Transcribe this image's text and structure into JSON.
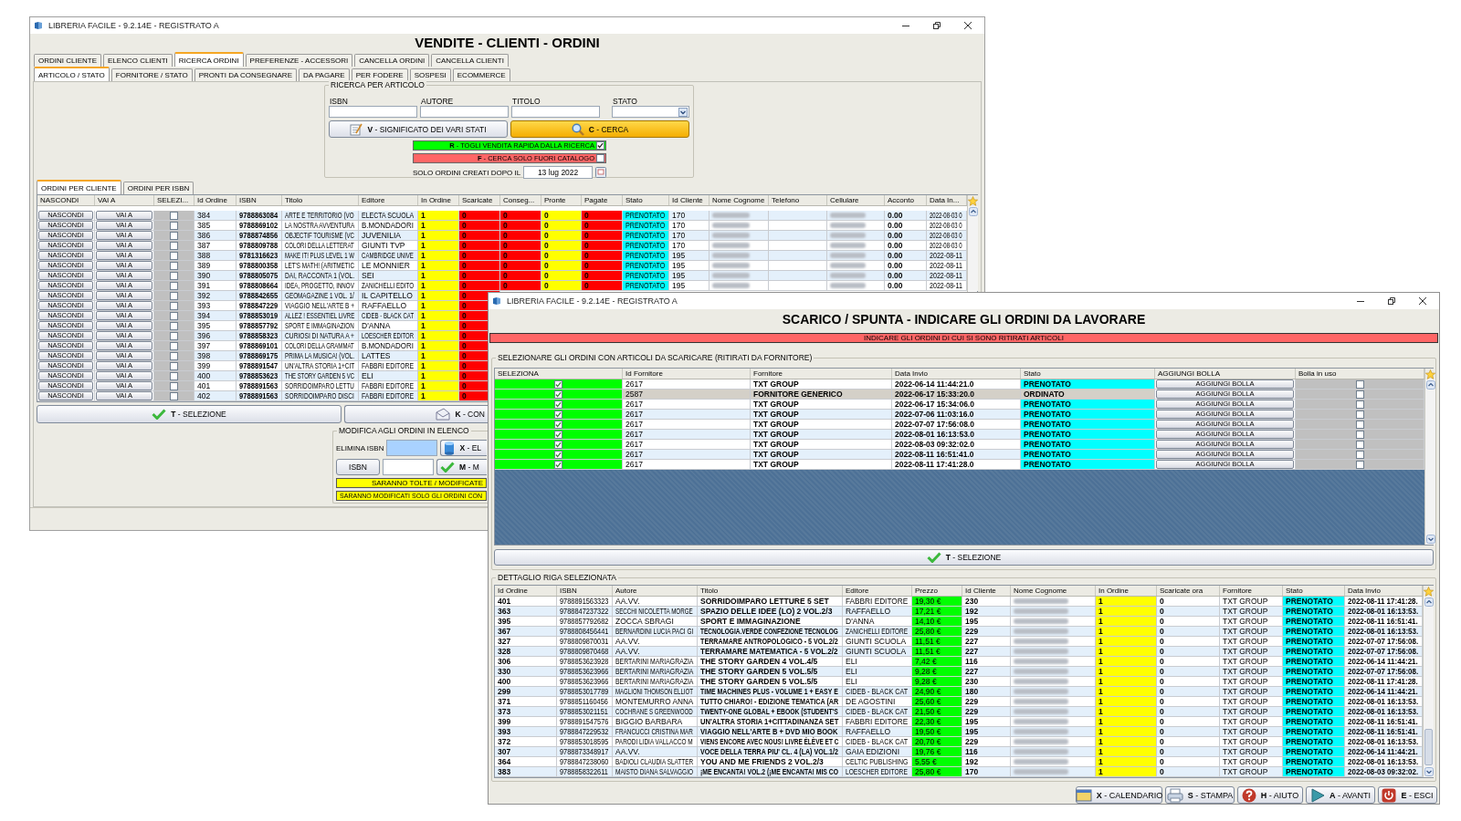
{
  "back_window": {
    "title": "LIBRERIA FACILE - 9.2.14E - REGISTRATO A",
    "heading": "VENDITE - CLIENTI - ORDINI",
    "tabs": [
      {
        "label": "ORDINI CLIENTE",
        "selected": false
      },
      {
        "label": "ELENCO CLIENTI",
        "selected": false
      },
      {
        "label": "RICERCA ORDINI",
        "selected": true
      },
      {
        "label": "PREFERENZE - ACCESSORI",
        "selected": false
      },
      {
        "label": "CANCELLA ORDINI",
        "selected": false
      },
      {
        "label": "CANCELLA CLIENTI",
        "selected": false
      }
    ],
    "subtabs": [
      {
        "label": "ARTICOLO / STATO",
        "selected": true
      },
      {
        "label": "FORNITORE / STATO",
        "selected": false
      },
      {
        "label": "PRONTI DA CONSEGNARE",
        "selected": false
      },
      {
        "label": "DA PAGARE",
        "selected": false
      },
      {
        "label": "PER FODERE",
        "selected": false
      },
      {
        "label": "SOSPESI",
        "selected": false
      },
      {
        "label": "ECOMMERCE",
        "selected": false
      }
    ],
    "search": {
      "legend": "RICERCA PER ARTICOLO",
      "fields": [
        {
          "label": "ISBN",
          "kind": "text"
        },
        {
          "label": "AUTORE",
          "kind": "text"
        },
        {
          "label": "TITOLO",
          "kind": "text"
        },
        {
          "label": "STATO",
          "kind": "dropdown"
        }
      ],
      "states_button": "**V** - SIGNIFICATO DEI VARI STATI",
      "search_button": "**C** - CERCA",
      "toggles": [
        {
          "label": "**R** - TOGLI VENDITA RAPIDA DALLA RICERCA",
          "checked": true,
          "color": "#00ff00"
        },
        {
          "label": "**F** - CERCA SOLO FUORI CATALOGO",
          "checked": false,
          "color": "#ff6666"
        }
      ],
      "date_label": "SOLO ORDINI CREATI DOPO IL",
      "date_value": "13 lug 2022"
    },
    "list_tabs": [
      {
        "label": "ORDINI PER CLIENTE",
        "selected": true
      },
      {
        "label": "ORDINI PER ISBN",
        "selected": false
      }
    ],
    "table": {
      "columns": [
        {
          "label": "NASCONDI",
          "kind": "button"
        },
        {
          "label": "VAI A",
          "kind": "button"
        },
        {
          "label": "SELEZI...",
          "kind": "greycheck"
        },
        {
          "label": "Id Ordine",
          "kind": "text"
        },
        {
          "label": "ISBN",
          "kind": "bold"
        },
        {
          "label": "Titolo",
          "kind": "text"
        },
        {
          "label": "Editore",
          "kind": "text"
        },
        {
          "label": "In Ordine",
          "kind": "yellow"
        },
        {
          "label": "Scaricate",
          "kind": "red"
        },
        {
          "label": "Conseg...",
          "kind": "red"
        },
        {
          "label": "Pronte",
          "kind": "yellow"
        },
        {
          "label": "Pagate",
          "kind": "red"
        },
        {
          "label": "Stato",
          "kind": "cyan"
        },
        {
          "label": "Id Cliente",
          "kind": "text"
        },
        {
          "label": "Nome Cognome",
          "kind": "blurred"
        },
        {
          "label": "Telefono",
          "kind": "empty"
        },
        {
          "label": "Cellulare",
          "kind": "blurred"
        },
        {
          "label": "Acconto",
          "kind": "bold"
        },
        {
          "label": "Data In...",
          "kind": "text"
        }
      ],
      "rows": [
        {
          "checked": false,
          "cells": [
            "NASCONDI",
            "VAI A",
            "",
            "384",
            "9788863084",
            "ARTE E TERRITORIO (VO",
            "ELECTA SCUOLA",
            "1",
            "0",
            "0",
            "0",
            "0",
            "PRENOTATO",
            "170",
            "",
            "",
            "",
            "0.00",
            "2022-08-03 0"
          ]
        },
        {
          "checked": false,
          "cells": [
            "NASCONDI",
            "VAI A",
            "",
            "385",
            "9788869102",
            "LA NOSTRA AVVENTURA",
            "B.MONDADORI",
            "1",
            "0",
            "0",
            "0",
            "0",
            "PRENOTATO",
            "170",
            "",
            "",
            "",
            "0.00",
            "2022-08-03 0"
          ]
        },
        {
          "checked": false,
          "cells": [
            "NASCONDI",
            "VAI A",
            "",
            "386",
            "9788874856",
            "OBJECTIF TOURISME (VC",
            "JUVENILIA",
            "1",
            "0",
            "0",
            "0",
            "0",
            "PRENOTATO",
            "170",
            "",
            "",
            "",
            "0.00",
            "2022-08-03 0"
          ]
        },
        {
          "checked": false,
          "cells": [
            "NASCONDI",
            "VAI A",
            "",
            "387",
            "9788809788",
            "COLORI DELLA LETTERAT",
            "GIUNTI TVP",
            "1",
            "0",
            "0",
            "0",
            "0",
            "PRENOTATO",
            "170",
            "",
            "",
            "",
            "0.00",
            "2022-08-03 0"
          ]
        },
        {
          "checked": false,
          "cells": [
            "NASCONDI",
            "VAI A",
            "",
            "388",
            "9781316623",
            "MAKE IT! PLUS LEVEL 1 W",
            "CAMBRIDGE UNIVE",
            "1",
            "0",
            "0",
            "0",
            "0",
            "PRENOTATO",
            "195",
            "",
            "",
            "",
            "0.00",
            "2022-08-11"
          ]
        },
        {
          "checked": false,
          "cells": [
            "NASCONDI",
            "VAI A",
            "",
            "389",
            "9788800358",
            "LET'S MATH! (ARITMETIC",
            "LE MONNIER",
            "1",
            "0",
            "0",
            "0",
            "0",
            "PRENOTATO",
            "195",
            "",
            "",
            "",
            "0.00",
            "2022-08-11"
          ]
        },
        {
          "checked": false,
          "cells": [
            "NASCONDI",
            "VAI A",
            "",
            "390",
            "9788805075",
            "DAI, RACCONTA 1 (VOL.",
            "SEI",
            "1",
            "0",
            "0",
            "0",
            "0",
            "PRENOTATO",
            "195",
            "",
            "",
            "",
            "0.00",
            "2022-08-11"
          ]
        },
        {
          "checked": false,
          "cells": [
            "NASCONDI",
            "VAI A",
            "",
            "391",
            "9788808664",
            "IDEA, PROGETTO, INNOV",
            "ZANICHELLI EDITO",
            "1",
            "0",
            "0",
            "0",
            "0",
            "PRENOTATO",
            "195",
            "",
            "",
            "",
            "0.00",
            "2022-08-11"
          ]
        },
        {
          "checked": false,
          "cells": [
            "NASCONDI",
            "VAI A",
            "",
            "392",
            "9788842655",
            "GEOMAGAZINE 1 VOL. 1/",
            "IL CAPITELLO",
            "1",
            "0"
          ]
        },
        {
          "checked": false,
          "cells": [
            "NASCONDI",
            "VAI A",
            "",
            "393",
            "9788847229",
            "VIAGGIO NELL'ARTE B +",
            "RAFFAELLO",
            "1",
            "0"
          ]
        },
        {
          "checked": false,
          "cells": [
            "NASCONDI",
            "VAI A",
            "",
            "394",
            "9788853019",
            "ALLEZ ! ESSENTIEL LIVRE",
            "CIDEB - BLACK CAT",
            "1",
            "0"
          ]
        },
        {
          "checked": false,
          "cells": [
            "NASCONDI",
            "VAI A",
            "",
            "395",
            "9788857792",
            "SPORT E IMMAGINAZION",
            "D'ANNA",
            "1",
            "0"
          ]
        },
        {
          "checked": false,
          "cells": [
            "NASCONDI",
            "VAI A",
            "",
            "396",
            "9788858323",
            "CURIOSI DI NATURA A +",
            "LOESCHER EDITOR",
            "1",
            "0"
          ]
        },
        {
          "checked": false,
          "cells": [
            "NASCONDI",
            "VAI A",
            "",
            "397",
            "9788869101",
            "COLORI DELLA GRAMMAT",
            "B.MONDADORI",
            "1",
            "0"
          ]
        },
        {
          "checked": false,
          "cells": [
            "NASCONDI",
            "VAI A",
            "",
            "398",
            "9788869175",
            "PRIMA LA MUSICA! (VOL.",
            "LATTES",
            "1",
            "0"
          ]
        },
        {
          "checked": false,
          "cells": [
            "NASCONDI",
            "VAI A",
            "",
            "399",
            "9788891547",
            "UN'ALTRA STORIA 1+CIT",
            "FABBRI EDITORE",
            "1",
            "0"
          ]
        },
        {
          "checked": false,
          "cells": [
            "NASCONDI",
            "VAI A",
            "",
            "400",
            "9788853623",
            "THE STORY GARDEN 5 VC",
            "ELI",
            "1",
            "0"
          ]
        },
        {
          "checked": false,
          "cells": [
            "NASCONDI",
            "VAI A",
            "",
            "401",
            "9788891563",
            "SORRIDOIMPARO LETTU",
            "FABBRI EDITORE",
            "1",
            "0"
          ]
        },
        {
          "checked": false,
          "cells": [
            "NASCONDI",
            "VAI A",
            "",
            "402",
            "9788891563",
            "SORRIDOIMPARO DISCI",
            "FABBRI EDITORE",
            "1",
            "0"
          ]
        }
      ]
    },
    "select_button": "**T** - SELEZIONE",
    "confirm_button": "**K** - CON",
    "modify": {
      "legend": "MODIFICA AGLI ORDINI IN ELENCO",
      "delete_label": "ELIMINA ISBN",
      "delete_button": "**X** - EL",
      "isbn_button": "ISBN",
      "apply_button": "**M** - M",
      "notes": [
        "SARANNO TOLTE / MODIFICATE",
        "SARANNO MODIFICATI SOLO GLI ORDINI CON"
      ]
    }
  },
  "front_window": {
    "title": "LIBRERIA FACILE - 9.2.14E - REGISTRATO A",
    "heading": "SCARICO / SPUNTA - INDICARE GLI ORDINI DA LAVORARE",
    "banner": "INDICARE GLI ORDINI DI CUI SI SONO RITIRATI ARTICOLI",
    "orders_group": "SELEZIONARE GLI ORDINI CON ARTICOLI DA SCARICARE (RITIRATI DA FORNITORE)",
    "orders_table": {
      "columns": [
        {
          "label": "SELEZIONA",
          "kind": "greencheck"
        },
        {
          "label": "Id Fornitore",
          "kind": "text"
        },
        {
          "label": "Fornitore",
          "kind": "bold"
        },
        {
          "label": "Data Invio",
          "kind": "bold"
        },
        {
          "label": "Stato",
          "kind": "status"
        },
        {
          "label": "AGGIUNGI BOLLA",
          "kind": "button"
        },
        {
          "label": "Bolla in uso",
          "kind": "greycheck"
        }
      ],
      "rows": [
        {
          "checked": true,
          "in_use": false,
          "selected": false,
          "cells": [
            "",
            "2617",
            "TXT GROUP",
            "2022-06-14 11:44:21.0",
            "PRENOTATO",
            "AGGIUNGI BOLLA",
            ""
          ]
        },
        {
          "checked": true,
          "in_use": false,
          "selected": true,
          "cells": [
            "",
            "2587",
            "FORNITORE GENERICO",
            "2022-06-17 15:33:20.0",
            "ORDINATO",
            "AGGIUNGI BOLLA",
            ""
          ]
        },
        {
          "checked": true,
          "in_use": false,
          "selected": false,
          "cells": [
            "",
            "2617",
            "TXT GROUP",
            "2022-06-17 15:34:06.0",
            "PRENOTATO",
            "AGGIUNGI BOLLA",
            ""
          ]
        },
        {
          "checked": true,
          "in_use": false,
          "selected": false,
          "cells": [
            "",
            "2617",
            "TXT GROUP",
            "2022-07-06 11:03:16.0",
            "PRENOTATO",
            "AGGIUNGI BOLLA",
            ""
          ]
        },
        {
          "checked": true,
          "in_use": false,
          "selected": false,
          "cells": [
            "",
            "2617",
            "TXT GROUP",
            "2022-07-07 17:56:08.0",
            "PRENOTATO",
            "AGGIUNGI BOLLA",
            ""
          ]
        },
        {
          "checked": true,
          "in_use": false,
          "selected": false,
          "cells": [
            "",
            "2617",
            "TXT GROUP",
            "2022-08-01 16:13:53.0",
            "PRENOTATO",
            "AGGIUNGI BOLLA",
            ""
          ]
        },
        {
          "checked": true,
          "in_use": false,
          "selected": false,
          "cells": [
            "",
            "2617",
            "TXT GROUP",
            "2022-08-03 09:32:02.0",
            "PRENOTATO",
            "AGGIUNGI BOLLA",
            ""
          ]
        },
        {
          "checked": true,
          "in_use": false,
          "selected": false,
          "cells": [
            "",
            "2617",
            "TXT GROUP",
            "2022-08-11 16:51:41.0",
            "PRENOTATO",
            "AGGIUNGI BOLLA",
            ""
          ]
        },
        {
          "checked": true,
          "in_use": false,
          "selected": false,
          "cells": [
            "",
            "2617",
            "TXT GROUP",
            "2022-08-11 17:41:28.0",
            "PRENOTATO",
            "AGGIUNGI BOLLA",
            ""
          ]
        }
      ]
    },
    "select_button": "**T** - SELEZIONE",
    "detail_group": "DETTAGLIO RIGA SELEZIONATA",
    "detail_table": {
      "columns": [
        {
          "label": "Id Ordine",
          "kind": "bold"
        },
        {
          "label": "ISBN",
          "kind": "text"
        },
        {
          "label": "Autore",
          "kind": "text"
        },
        {
          "label": "Titolo",
          "kind": "bold"
        },
        {
          "label": "Editore",
          "kind": "text"
        },
        {
          "label": "Prezzo",
          "kind": "green"
        },
        {
          "label": "Id Cliente",
          "kind": "bold"
        },
        {
          "label": "Nome Cognome",
          "kind": "blurred"
        },
        {
          "label": "In Ordine",
          "kind": "yellow"
        },
        {
          "label": "Scaricate ora",
          "kind": "bold"
        },
        {
          "label": "Fornitore",
          "kind": "text"
        },
        {
          "label": "Stato",
          "kind": "status"
        },
        {
          "label": "Data Invio",
          "kind": "bold"
        }
      ],
      "rows": [
        {
          "cells": [
            "401",
            "9788891563323",
            "AA.VV.",
            "SORRIDOIMPARO LETTURE 5 SET",
            "FABBRI EDITORE",
            "19,30 €",
            "230",
            "",
            "1",
            "0",
            "TXT GROUP",
            "PRENOTATO",
            "2022-08-11 17:41:28."
          ]
        },
        {
          "cells": [
            "363",
            "9788847237322",
            "SECCHI NICOLETTA MORGE",
            "SPAZIO DELLE IDEE (LO) 2 VOL.2/3",
            "RAFFAELLO",
            "17,21 €",
            "192",
            "",
            "1",
            "0",
            "TXT GROUP",
            "PRENOTATO",
            "2022-08-01 16:13:53."
          ]
        },
        {
          "cells": [
            "395",
            "9788857792682",
            "ZOCCA SBRAGI",
            "SPORT E IMMAGINAZIONE",
            "D'ANNA",
            "14,10 €",
            "195",
            "",
            "1",
            "0",
            "TXT GROUP",
            "PRENOTATO",
            "2022-08-11 16:51:41."
          ]
        },
        {
          "cells": [
            "367",
            "9788808456441",
            "BERNARDINI LUCIA PACI GI",
            "TECNOLOGIA.VERDE CONFEZIONE TECNOLOG",
            "ZANICHELLI EDITORE",
            "25,80 €",
            "229",
            "",
            "1",
            "0",
            "TXT GROUP",
            "PRENOTATO",
            "2022-08-01 16:13:53."
          ]
        },
        {
          "cells": [
            "327",
            "9788809870031",
            "AA.VV.",
            "TERRAMARE ANTROPOLOGICO - 5 VOL.2/2",
            "GIUNTI SCUOLA",
            "11,51 €",
            "227",
            "",
            "1",
            "0",
            "TXT GROUP",
            "PRENOTATO",
            "2022-07-07 17:56:08."
          ]
        },
        {
          "cells": [
            "328",
            "9788809870468",
            "AA.VV.",
            "TERRAMARE MATEMATICA - 5 VOL.2/2",
            "GIUNTI SCUOLA",
            "11,51 €",
            "227",
            "",
            "1",
            "0",
            "TXT GROUP",
            "PRENOTATO",
            "2022-07-07 17:56:08."
          ]
        },
        {
          "cells": [
            "306",
            "9788853623928",
            "BERTARINI MARIAGRAZIA",
            "THE STORY GARDEN 4 VOL.4/5",
            "ELI",
            "7,42 €",
            "116",
            "",
            "1",
            "0",
            "TXT GROUP",
            "PRENOTATO",
            "2022-06-14 11:44:21."
          ]
        },
        {
          "cells": [
            "330",
            "9788853623966",
            "BERTARINI MARIAGRAZIA",
            "THE STORY GARDEN 5 VOL.5/5",
            "ELI",
            "9,28 €",
            "227",
            "",
            "1",
            "0",
            "TXT GROUP",
            "PRENOTATO",
            "2022-07-07 17:56:08."
          ]
        },
        {
          "cells": [
            "400",
            "9788853623966",
            "BERTARINI MARIAGRAZIA",
            "THE STORY GARDEN 5 VOL.5/5",
            "ELI",
            "9,28 €",
            "230",
            "",
            "1",
            "0",
            "TXT GROUP",
            "PRENOTATO",
            "2022-08-11 17:41:28."
          ]
        },
        {
          "cells": [
            "299",
            "9788853017789",
            "MAGLIONI THOMSON ELLIOT",
            "TIME MACHINES PLUS - VOLUME 1 + EASY E",
            "CIDEB - BLACK CAT",
            "24,90 €",
            "180",
            "",
            "1",
            "0",
            "TXT GROUP",
            "PRENOTATO",
            "2022-06-14 11:44:21."
          ]
        },
        {
          "cells": [
            "371",
            "9788851160456",
            "MONTEMURRO ANNA",
            "TUTTO CHIARO! - EDIZIONE TEMATICA (AR",
            "DE AGOSTINI",
            "25,60 €",
            "229",
            "",
            "1",
            "0",
            "TXT GROUP",
            "PRENOTATO",
            "2022-08-01 16:13:53."
          ]
        },
        {
          "cells": [
            "373",
            "9788853021151",
            "COCHRANE S GREENWOOD",
            "TWENTY-ONE GLOBAL + EBOOK (STUDENT'S",
            "CIDEB - BLACK CAT",
            "21,50 €",
            "229",
            "",
            "1",
            "0",
            "TXT GROUP",
            "PRENOTATO",
            "2022-08-01 16:13:53."
          ]
        },
        {
          "cells": [
            "399",
            "9788891547576",
            "BIGGIO BARBARA",
            "UN'ALTRA STORIA 1+CITTADINANZA SET",
            "FABBRI EDITORE",
            "22,30 €",
            "195",
            "",
            "1",
            "0",
            "TXT GROUP",
            "PRENOTATO",
            "2022-08-11 16:51:41."
          ]
        },
        {
          "cells": [
            "393",
            "9788847229532",
            "FRANCUCCI CRISTINA MAR",
            "VIAGGIO NELL'ARTE B + DVD MIO BOOK",
            "RAFFAELLO",
            "19,50 €",
            "195",
            "",
            "1",
            "0",
            "TXT GROUP",
            "PRENOTATO",
            "2022-08-11 16:51:41."
          ]
        },
        {
          "cells": [
            "372",
            "9788853018595",
            "PARODI LIDIA VALLACCO M",
            "VIENS ENCORE AVEC NOUS! LIVRE ÉLÈVE ET C",
            "CIDEB - BLACK CAT",
            "20,70 €",
            "229",
            "",
            "1",
            "0",
            "TXT GROUP",
            "PRENOTATO",
            "2022-08-01 16:13:53."
          ]
        },
        {
          "cells": [
            "307",
            "9788873348917",
            "AA.VV.",
            "VOCE DELLA TERRA PIU' CL. 4 (LA) VOL.1/2",
            "GAIA EDIZIONI",
            "19,76 €",
            "116",
            "",
            "1",
            "0",
            "TXT GROUP",
            "PRENOTATO",
            "2022-06-14 11:44:21."
          ]
        },
        {
          "cells": [
            "364",
            "9788847238060",
            "BADIOLI CLAUDIA SLATTER",
            "YOU AND ME FRIENDS 2 VOL.2/3",
            "CELTIC PUBLISHING",
            "5,55 €",
            "192",
            "",
            "1",
            "0",
            "TXT GROUP",
            "PRENOTATO",
            "2022-08-01 16:13:53."
          ]
        },
        {
          "cells": [
            "383",
            "9788858322611",
            "MAISTO DIANA SALVAGGIO",
            "¡ME ENCANTA! VOL.2 (¡ME ENCANTA! MIS CO",
            "LOESCHER EDITORE",
            "25,80 €",
            "170",
            "",
            "1",
            "0",
            "TXT GROUP",
            "PRENOTATO",
            "2022-08-03 09:32:02."
          ]
        }
      ]
    },
    "buttons": [
      {
        "label": "**X** - CALENDARIO",
        "kind": "calendar"
      },
      {
        "label": "**S** - STAMPA",
        "kind": "print"
      },
      {
        "label": "**H** - AIUTO",
        "kind": "help"
      },
      {
        "label": "**A** - AVANTI",
        "kind": "next"
      },
      {
        "label": "**E** - ESCI",
        "kind": "exit"
      }
    ]
  }
}
